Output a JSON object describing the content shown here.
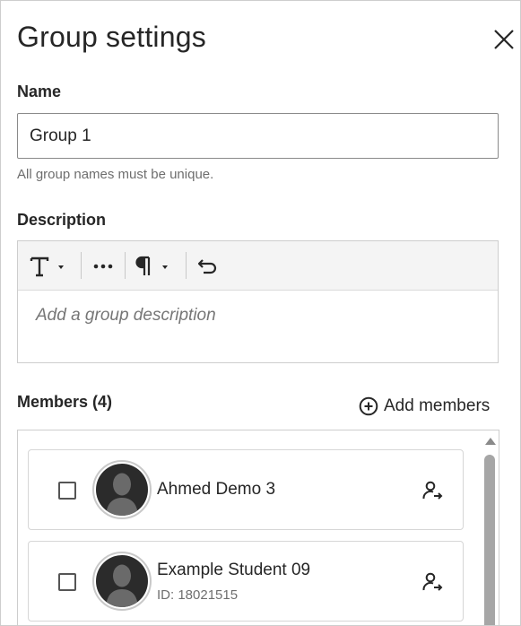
{
  "header": {
    "title": "Group settings",
    "close_icon": "close-icon"
  },
  "name_field": {
    "label": "Name",
    "value": "Group 1",
    "helper": "All group names must be unique."
  },
  "description": {
    "label": "Description",
    "placeholder": "Add a group description",
    "toolbar": [
      "text-format-icon",
      "more-options-icon",
      "paragraph-icon",
      "undo-icon"
    ]
  },
  "members": {
    "label": "Members (4)",
    "add_label": "Add members",
    "items": [
      {
        "name": "Ahmed Demo 3",
        "id": ""
      },
      {
        "name": "Example Student 09",
        "id": "ID: 18021515"
      }
    ]
  },
  "colors": {
    "text": "#262626",
    "muted": "#6e6e6e",
    "border": "#cdcdcd",
    "avatar": "#2b2b2b"
  }
}
